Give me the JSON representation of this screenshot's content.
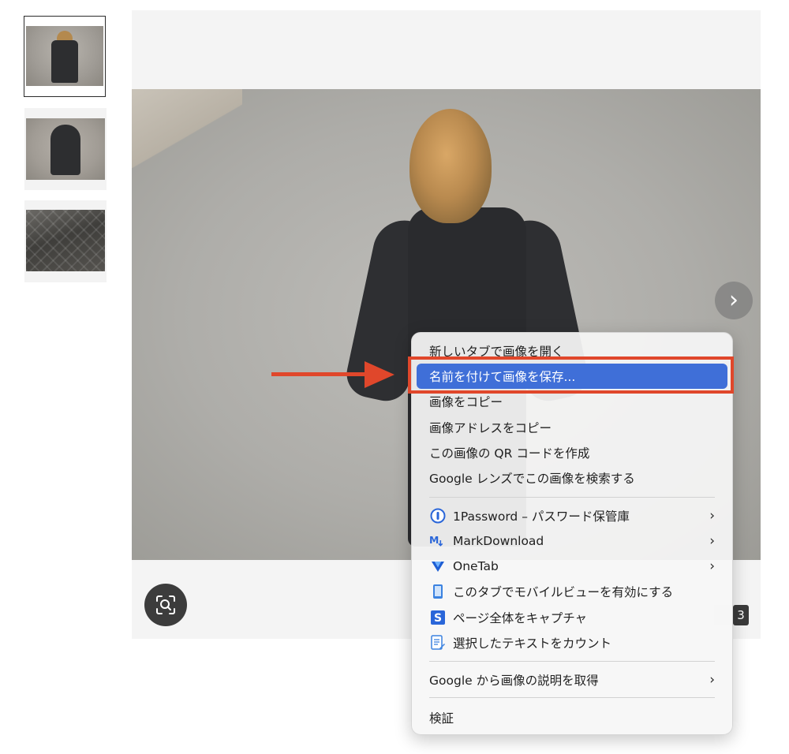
{
  "thumbnails": [
    {
      "label": "coat-with-fur-hood",
      "selected": true
    },
    {
      "label": "coat-hood-up",
      "selected": false
    },
    {
      "label": "quilted-lining",
      "selected": false
    }
  ],
  "viewer": {
    "next_icon": "chevron-right-icon",
    "next_glyph": "›",
    "lens_icon": "lens-search-icon",
    "counter_value": "3"
  },
  "context_menu": {
    "items": [
      {
        "label": "新しいタブで画像を開く"
      },
      {
        "label": "名前を付けて画像を保存...",
        "highlighted": true
      },
      {
        "label": "画像をコピー"
      },
      {
        "label": "画像アドレスをコピー"
      },
      {
        "label": "この画像の QR コードを作成"
      },
      {
        "label": "Google レンズでこの画像を検索する"
      }
    ],
    "extensions": [
      {
        "label": "1Password – パスワード保管庫",
        "icon": "onepassword-icon",
        "submenu": true
      },
      {
        "label": "MarkDownload",
        "icon": "markdownload-icon",
        "submenu": true
      },
      {
        "label": "OneTab",
        "icon": "onetab-icon",
        "submenu": true
      },
      {
        "label": "このタブでモバイルビューを有効にする",
        "icon": "mobile-view-icon",
        "submenu": false
      },
      {
        "label": "ページ全体をキャプチャ",
        "icon": "capture-icon",
        "submenu": false
      },
      {
        "label": "選択したテキストをカウント",
        "icon": "count-text-icon",
        "submenu": false
      }
    ],
    "google_desc": {
      "label": "Google から画像の説明を取得",
      "submenu": true
    },
    "inspect": {
      "label": "検証"
    },
    "chevron_glyph": "›"
  },
  "colors": {
    "highlight": "#3f6fd8",
    "annotation_red": "#e0472b"
  }
}
